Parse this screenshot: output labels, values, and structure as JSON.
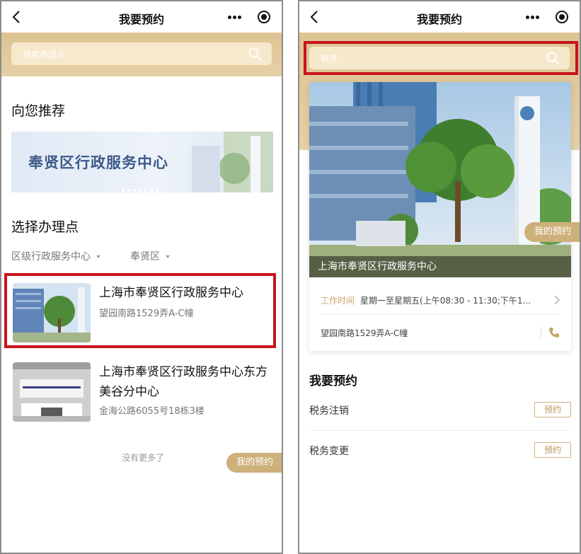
{
  "left": {
    "title": "我要预约",
    "search_placeholder": "搜索办理点",
    "recommend_title": "向您推荐",
    "banner_text": "奉贤区行政服务中心",
    "select_title": "选择办理点",
    "filters": [
      "区级行政服务中心",
      "奉贤区"
    ],
    "centers": [
      {
        "name": "上海市奉贤区行政服务中心",
        "address": "望园南路1529弄A-C幢"
      },
      {
        "name": "上海市奉贤区行政服务中心东方美谷分中心",
        "address": "金海公路6055号18栋3楼"
      }
    ],
    "no_more": "没有更多了",
    "my_appointments": "我的预约"
  },
  "right": {
    "title": "我要预约",
    "search_value": "税务",
    "photo_caption": "上海市奉贤区行政服务中心",
    "my_appointments": "我的预约",
    "work_time_label": "工作时间",
    "work_time_value": "星期一至星期五(上午08:30 - 11:30;下午1...",
    "address": "望园南路1529弄A-C幢",
    "section_title": "我要预约",
    "services": [
      {
        "name": "税务注销",
        "action": "预约"
      },
      {
        "name": "税务变更",
        "action": "预约"
      }
    ]
  },
  "colors": {
    "accent_gold": "#ceb07b",
    "highlight_red": "#c8141c"
  },
  "icons": [
    "back-arrow-icon",
    "more-dots-icon",
    "target-icon",
    "search-icon",
    "chevron-right-icon",
    "phone-icon",
    "caret-down-icon"
  ]
}
